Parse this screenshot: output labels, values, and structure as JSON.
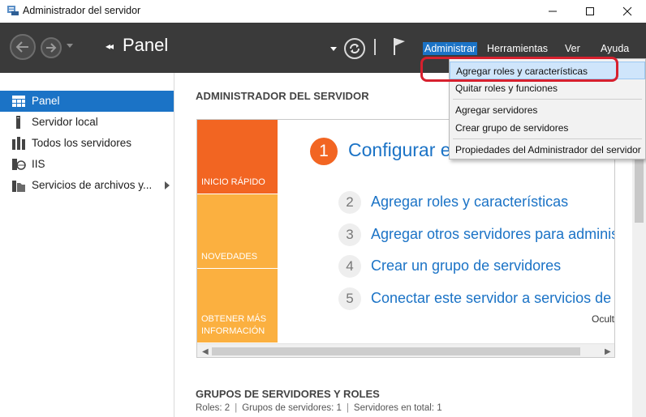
{
  "window": {
    "title": "Administrador del servidor"
  },
  "header": {
    "breadcrumb_arrows": "◂◂",
    "page_title": "Panel",
    "menu": {
      "admin": "Administrar",
      "tools": "Herramientas",
      "view": "Ver",
      "help": "Ayuda"
    }
  },
  "admin_menu": {
    "items": [
      "Agregar roles y características",
      "Quitar roles y funciones",
      "Agregar servidores",
      "Crear grupo de servidores",
      "Propiedades del Administrador del servidor"
    ],
    "highlighted_index": 0
  },
  "sidebar": {
    "items": [
      {
        "label": "Panel",
        "icon": "dashboard-icon",
        "selected": true
      },
      {
        "label": "Servidor local",
        "icon": "server-icon"
      },
      {
        "label": "Todos los servidores",
        "icon": "servers-icon"
      },
      {
        "label": "IIS",
        "icon": "iis-icon"
      },
      {
        "label": "Servicios de archivos y...",
        "icon": "file-services-icon",
        "has_submenu": true
      }
    ]
  },
  "main": {
    "section_title": "ADMINISTRADOR DEL SERVIDOR",
    "tiles": {
      "quick_start": "INICIO RÁPIDO",
      "whats_new": "NOVEDADES",
      "learn_more": "OBTENER MÁS INFORMACIÓN"
    },
    "steps": [
      {
        "num": "1",
        "text": "Configurar este servidor local"
      },
      {
        "num": "2",
        "text": "Agregar roles y características"
      },
      {
        "num": "3",
        "text": "Agregar otros servidores para administrar"
      },
      {
        "num": "4",
        "text": "Crear un grupo de servidores"
      },
      {
        "num": "5",
        "text": "Conectar este servidor a servicios de nube"
      }
    ],
    "hide_link": "Ocultar",
    "groups_title": "GRUPOS DE SERVIDORES Y ROLES",
    "groups_stats": {
      "roles": "Roles: 2",
      "groups": "Grupos de servidores: 1",
      "total": "Servidores en total: 1"
    }
  },
  "colors": {
    "header_bg": "#3a3a3a",
    "accent": "#1b73c6",
    "quick_start_tile": "#f26522",
    "secondary_tile": "#fbb040",
    "highlight_ring": "#d7202e"
  }
}
